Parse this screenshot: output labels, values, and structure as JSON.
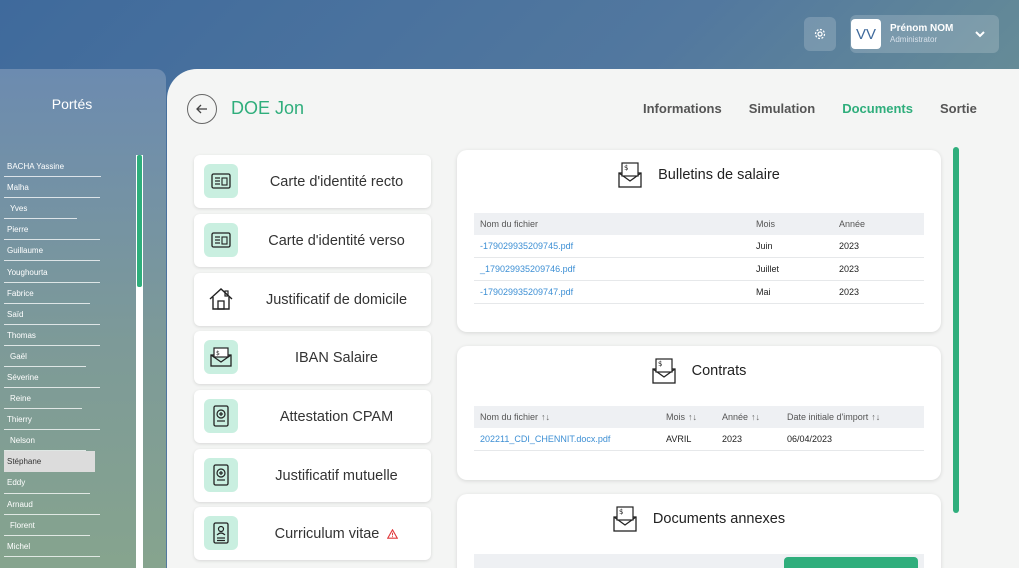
{
  "header": {
    "settings_icon": "gear-icon",
    "user": {
      "initials": "VV",
      "name": "Prénom NOM",
      "role": "Administrator"
    }
  },
  "sidebar": {
    "title": "Portés",
    "items": [
      {
        "label": "BACHA Yassine"
      },
      {
        "label": "Malha"
      },
      {
        "label": "Yves"
      },
      {
        "label": "Pierre"
      },
      {
        "label": "Guillaume"
      },
      {
        "label": "Youghourta"
      },
      {
        "label": "Fabrice"
      },
      {
        "label": "Saïd"
      },
      {
        "label": "Thomas"
      },
      {
        "label": "Gaël"
      },
      {
        "label": "Séverine"
      },
      {
        "label": "Reine"
      },
      {
        "label": "Thierry"
      },
      {
        "label": "Nelson"
      },
      {
        "label": "Stéphane",
        "selected": true
      },
      {
        "label": "Eddy"
      },
      {
        "label": "Arnaud"
      },
      {
        "label": "Florent"
      },
      {
        "label": "Michel"
      }
    ]
  },
  "page": {
    "title": "DOE Jon",
    "tabs": [
      "Informations",
      "Simulation",
      "Documents",
      "Sortie"
    ],
    "active_tab": "Documents"
  },
  "documents": [
    {
      "label": "Carte d'identité recto",
      "icon": "id-card-icon"
    },
    {
      "label": "Carte d'identité verso",
      "icon": "id-card-icon"
    },
    {
      "label": "Justificatif de domicile",
      "icon": "house-icon"
    },
    {
      "label": "IBAN Salaire",
      "icon": "money-envelope-icon"
    },
    {
      "label": "Attestation CPAM",
      "icon": "medical-doc-icon"
    },
    {
      "label": "Justificatif mutuelle",
      "icon": "medical-doc-icon"
    },
    {
      "label": "Curriculum vitae",
      "icon": "cv-icon",
      "warning": true
    }
  ],
  "bulletins": {
    "title": "Bulletins de salaire",
    "columns": [
      "Nom du fichier",
      "Mois",
      "Année"
    ],
    "rows": [
      [
        "-179029935209745.pdf",
        "Juin",
        "2023"
      ],
      [
        "_179029935209746.pdf",
        "Juillet",
        "2023"
      ],
      [
        "-179029935209747.pdf",
        "Mai",
        "2023"
      ]
    ]
  },
  "contrats": {
    "title": "Contrats",
    "columns": [
      "Nom du fichier",
      "Mois",
      "Année",
      "Date initiale d'import"
    ],
    "sort_icon": "↑↓",
    "rows": [
      [
        "202211_CDI_CHENNIT.docx.pdf",
        "AVRIL",
        "2023",
        "06/04/2023"
      ]
    ]
  },
  "annexes": {
    "title": "Documents annexes"
  },
  "colors": {
    "accent": "#2fae7c",
    "link": "#3d8fd4",
    "icon_bg": "#c9efe0"
  }
}
